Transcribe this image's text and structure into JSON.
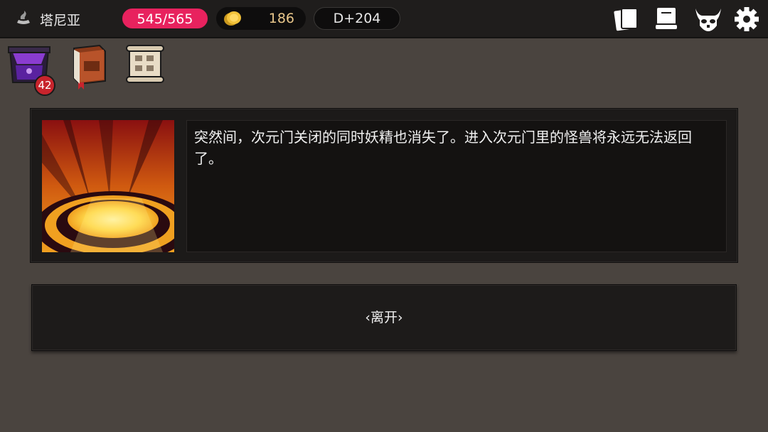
{
  "header": {
    "location_icon": "sweeping-icon",
    "location_name": "塔尼亚",
    "hp": "545/565",
    "gold_icon": "coins-icon",
    "gold": "186",
    "day": "D+204",
    "icons": [
      "cards-icon",
      "scroll-icon",
      "monster-skull-icon",
      "gear-icon"
    ]
  },
  "inventory": {
    "chest_icon": "purple-chest-icon",
    "chest_count": "42",
    "book_icon": "book-icon",
    "map_icon": "map-scroll-icon"
  },
  "event": {
    "image_icon": "portal-light-image",
    "text": "突然间，次元门关闭的同时妖精也消失了。进入次元门里的怪兽将永远无法返回了。"
  },
  "actions": {
    "leave_label": "‹离开›"
  },
  "colors": {
    "hp_pill": "#e8225e",
    "gold_text": "#e9c78b",
    "background": "#4a443f"
  }
}
